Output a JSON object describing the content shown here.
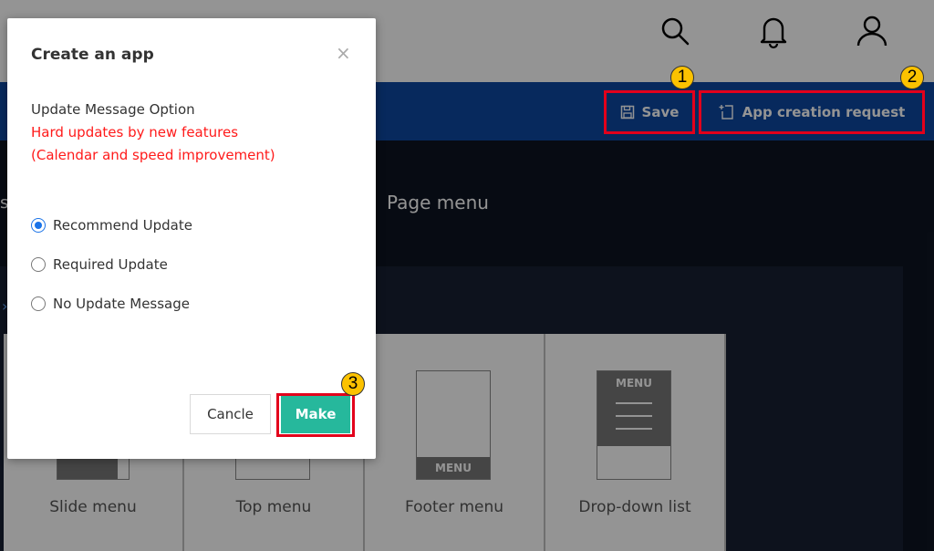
{
  "header": {
    "icons": [
      "search-icon",
      "bell-icon",
      "user-icon"
    ]
  },
  "toolbar": {
    "save_label": "Save",
    "app_request_label": "App creation request"
  },
  "annotations": [
    "1",
    "2",
    "3"
  ],
  "main": {
    "page_menu_label": "Page menu",
    "tiles": [
      {
        "label": "Slide menu"
      },
      {
        "label": "Top menu"
      },
      {
        "label": "Footer menu",
        "badge": "MENU"
      },
      {
        "label": "Drop-down list",
        "badge": "MENU"
      }
    ]
  },
  "modal": {
    "title": "Create an app",
    "close_glyph": "×",
    "option_title": "Update Message Option",
    "warning_line1": "Hard updates by new features",
    "warning_line2": "(Calendar and speed improvement)",
    "options": [
      {
        "label": "Recommend Update",
        "checked": true
      },
      {
        "label": "Required Update",
        "checked": false
      },
      {
        "label": "No Update Message",
        "checked": false
      }
    ],
    "cancel_label": "Cancle",
    "make_label": "Make"
  },
  "colors": {
    "toolbar_blue": "#0d47a1",
    "make_button": "#26b89c",
    "warning_red": "#ff1a1a",
    "highlight_red": "#e3001b",
    "badge_yellow": "#fcc200"
  }
}
